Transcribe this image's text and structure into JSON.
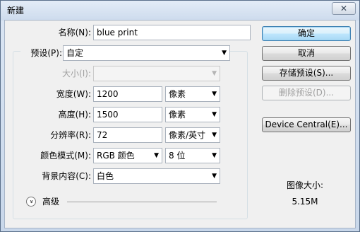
{
  "window": {
    "title": "新建",
    "close": "✕"
  },
  "name": {
    "label": "名称(N):",
    "value": "blue print"
  },
  "preset": {
    "label": "预设(P):",
    "value": "自定"
  },
  "size": {
    "label": "大小(I):",
    "value": ""
  },
  "width": {
    "label": "宽度(W):",
    "value": "1200",
    "unit": "像素"
  },
  "height": {
    "label": "高度(H):",
    "value": "1500",
    "unit": "像素"
  },
  "resolution": {
    "label": "分辨率(R):",
    "value": "72",
    "unit": "像素/英寸"
  },
  "color_mode": {
    "label": "颜色模式(M):",
    "value": "RGB 颜色",
    "depth": "8 位"
  },
  "background": {
    "label": "背景内容(C):",
    "value": "白色"
  },
  "advanced": {
    "label": "高级",
    "icon": "double-chevron-down-icon",
    "glyph": "»"
  },
  "buttons": {
    "ok": "确定",
    "cancel": "取消",
    "save_preset": "存储预设(S)...",
    "delete_preset": "删除预设(D)...",
    "device_central": "Device Central(E)..."
  },
  "image_size": {
    "label": "图像大小:",
    "value": "5.15M"
  },
  "dropdown_arrow": "▼"
}
